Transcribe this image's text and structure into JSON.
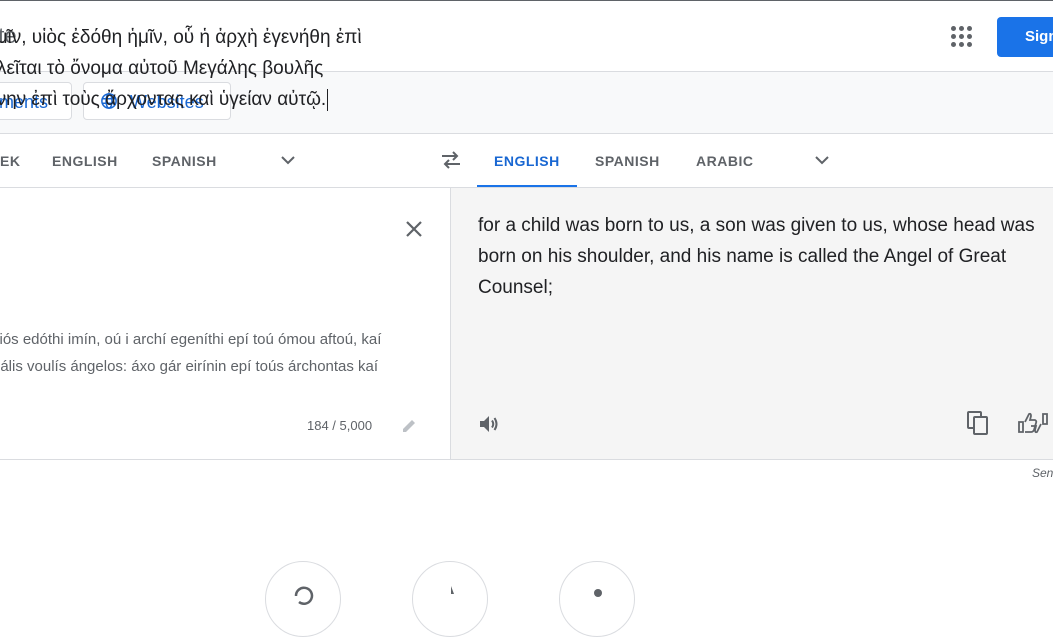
{
  "header": {
    "title": "Google Translate",
    "title_visible": "ate",
    "signin_label": "Sign in"
  },
  "modes": {
    "documents": "Documents",
    "documents_visible": "ments",
    "websites": "Websites"
  },
  "source_langs": {
    "detect_visible": "EK",
    "english": "ENGLISH",
    "spanish": "SPANISH"
  },
  "target_langs": {
    "english": "ENGLISH",
    "spanish": "SPANISH",
    "arabic": "ARABIC"
  },
  "source": {
    "line1": "ἡμῖν, υἱὸς ἐδόθη ἡμῖν, οὗ ἡ ἀρχὴ ἐγενήθη ἐπὶ",
    "line2": "αλεῖται τὸ ὄνομα αὐτοῦ Μεγάλης βουλῆς",
    "line3": "ήνην ἐπὶ τοὺς ἄρχοντας καὶ ὑγείαν αὐτῷ.",
    "translit1": "viós edóthi imín, oú i archí egeníthi epí toú ómou aftoú, kaí",
    "translit2": "gális voulís ángelos: áxo gár eirínin epí toús árchontas kaí",
    "char_count": "184 / 5,000"
  },
  "target": {
    "text": "for a child was born to us, a son was given to us, whose head was born on his shoulder, and his name is called the Angel of Great Counsel;"
  },
  "footer": {
    "send_feedback_visible": "Sen"
  },
  "colors": {
    "accent": "#1a73e8",
    "active_tab": "#1967d2",
    "muted": "#5f6368",
    "target_bg": "#f5f5f5"
  }
}
